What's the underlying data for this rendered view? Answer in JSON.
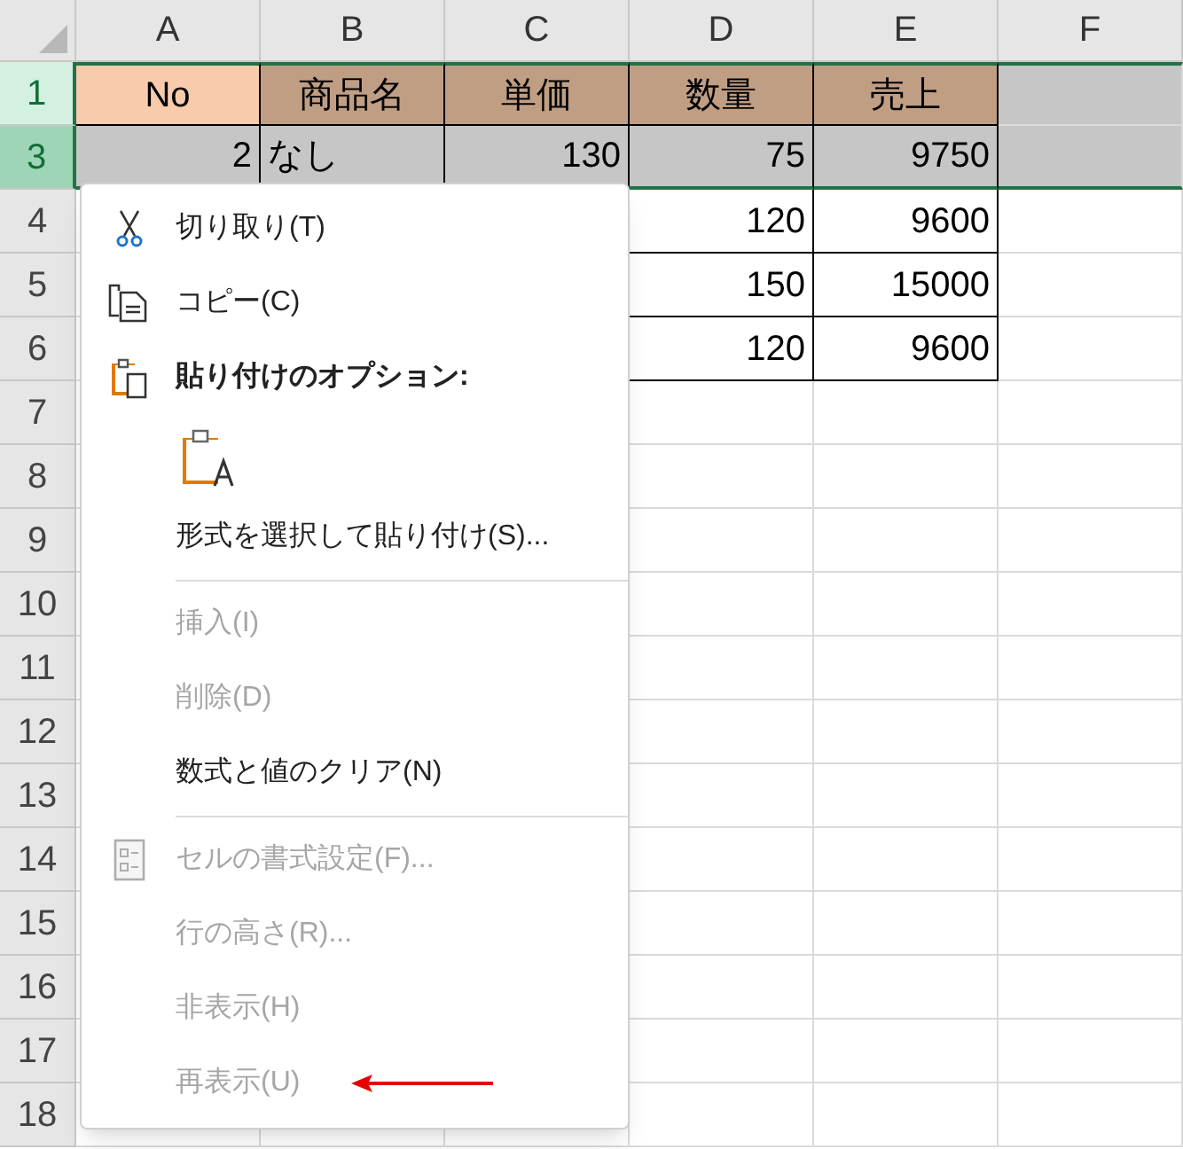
{
  "columns": [
    {
      "label": "A"
    },
    {
      "label": "B"
    },
    {
      "label": "C"
    },
    {
      "label": "D"
    },
    {
      "label": "E"
    },
    {
      "label": "F"
    }
  ],
  "rows": [
    {
      "header": "1",
      "kind": "heading",
      "selected": true,
      "active": false,
      "cells": [
        {
          "text": "No",
          "color": "#f8cbad",
          "bordered": true
        },
        {
          "text": "商品名",
          "color": "#c09e84",
          "bordered": true
        },
        {
          "text": "単価",
          "color": "#c09e84",
          "bordered": true
        },
        {
          "text": "数量",
          "color": "#c09e84",
          "bordered": true
        },
        {
          "text": "売上",
          "color": "#c09e84",
          "bordered": true
        },
        {
          "color": "#c6c6c6",
          "bordered": false
        }
      ]
    },
    {
      "header": "3",
      "kind": "data",
      "selected": true,
      "active": true,
      "cells": [
        {
          "text": "2",
          "color": "#c6c6c6",
          "bordered": true
        },
        {
          "text": "なし",
          "color": "#c6c6c6",
          "bordered": true
        },
        {
          "text": "130",
          "color": "#c6c6c6",
          "bordered": true
        },
        {
          "text": "75",
          "color": "#c6c6c6",
          "bordered": true
        },
        {
          "text": "9750",
          "color": "#c6c6c6",
          "bordered": true
        },
        {
          "color": "#c6c6c6",
          "bordered": false
        }
      ]
    },
    {
      "header": "4",
      "kind": "data",
      "selected": false,
      "active": false,
      "cells": [
        {
          "text": "120",
          "bordered": true
        },
        {
          "text": "9600",
          "bordered": true
        }
      ]
    },
    {
      "header": "5",
      "kind": "data",
      "selected": false,
      "active": false,
      "cells": [
        {
          "text": "150",
          "bordered": true
        },
        {
          "text": "15000",
          "bordered": true
        }
      ]
    },
    {
      "header": "6",
      "kind": "data",
      "selected": false,
      "active": false,
      "cells": [
        {
          "text": "120",
          "bordered": true
        },
        {
          "text": "9600",
          "bordered": true
        }
      ]
    },
    {
      "header": "7",
      "selected": false,
      "active": false
    },
    {
      "header": "8",
      "selected": false,
      "active": false
    },
    {
      "header": "9",
      "selected": false,
      "active": false
    },
    {
      "header": "10",
      "selected": false,
      "active": false
    },
    {
      "header": "11",
      "selected": false,
      "active": false
    },
    {
      "header": "12",
      "selected": false,
      "active": false
    },
    {
      "header": "13",
      "selected": false,
      "active": false
    },
    {
      "header": "14",
      "selected": false,
      "active": false
    },
    {
      "header": "15",
      "selected": false,
      "active": false
    },
    {
      "header": "16",
      "selected": false,
      "active": false
    },
    {
      "header": "17",
      "selected": false,
      "active": false
    },
    {
      "header": "18",
      "selected": false,
      "active": false
    }
  ],
  "context_menu": {
    "items": [
      {
        "kind": "item",
        "label": "切り取り(T)",
        "disabled": false,
        "marked": false
      },
      {
        "kind": "item",
        "label": "コピー(C)",
        "disabled": false,
        "marked": false
      },
      {
        "kind": "header",
        "label": "貼り付けのオプション:"
      },
      {
        "kind": "paste-options"
      },
      {
        "kind": "item",
        "label": "形式を選択して貼り付け(S)...",
        "disabled": false,
        "marked": false
      },
      {
        "kind": "separator"
      },
      {
        "kind": "item",
        "label": "挿入(I)",
        "disabled": true,
        "marked": false
      },
      {
        "kind": "item",
        "label": "削除(D)",
        "disabled": true,
        "marked": false
      },
      {
        "kind": "item",
        "label": "数式と値のクリア(N)",
        "disabled": false,
        "marked": false
      },
      {
        "kind": "separator"
      },
      {
        "kind": "item",
        "label": "セルの書式設定(F)...",
        "disabled": true,
        "marked": false
      },
      {
        "kind": "item",
        "label": "行の高さ(R)...",
        "disabled": true,
        "marked": false
      },
      {
        "kind": "item",
        "label": "非表示(H)",
        "disabled": true,
        "marked": false
      },
      {
        "kind": "item",
        "label": "再表示(U)",
        "disabled": true,
        "marked": true
      }
    ]
  }
}
